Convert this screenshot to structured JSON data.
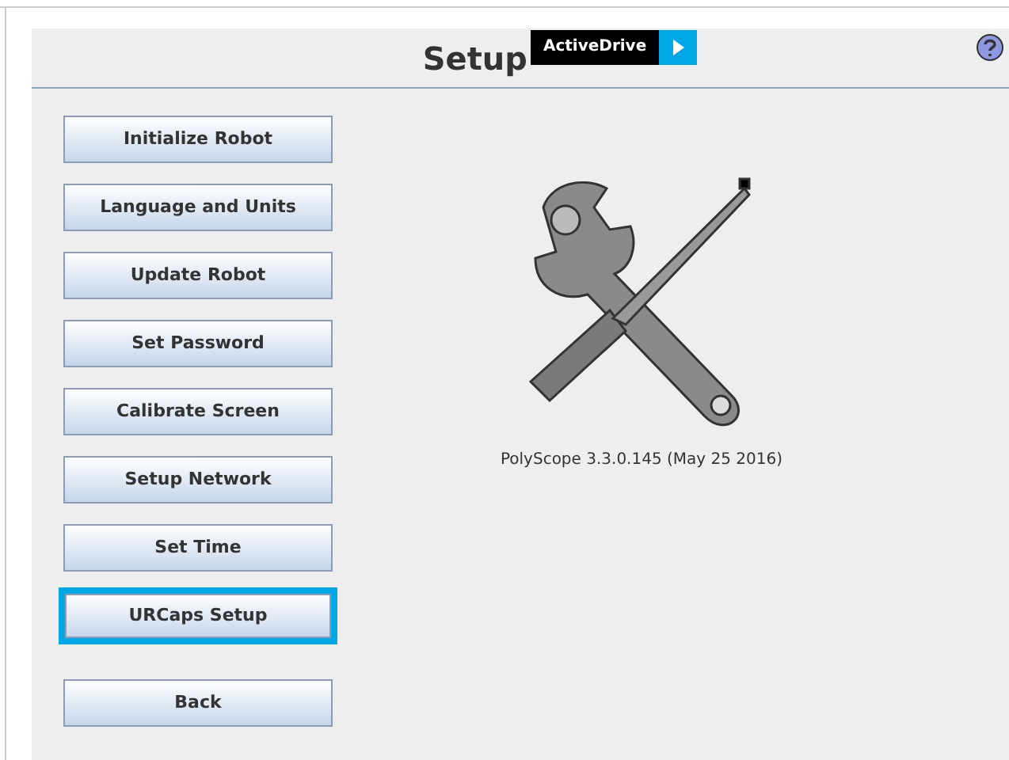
{
  "header": {
    "title": "Setup",
    "badge": {
      "label": "ActiveDrive"
    }
  },
  "menu": [
    {
      "label": "Initialize Robot",
      "selected": false
    },
    {
      "label": "Language and Units",
      "selected": false
    },
    {
      "label": "Update Robot",
      "selected": false
    },
    {
      "label": "Set Password",
      "selected": false
    },
    {
      "label": "Calibrate Screen",
      "selected": false
    },
    {
      "label": "Setup Network",
      "selected": false
    },
    {
      "label": "Set Time",
      "selected": false
    },
    {
      "label": "URCaps Setup",
      "selected": true
    }
  ],
  "back_button": {
    "label": "Back"
  },
  "version": "PolyScope 3.3.0.145 (May 25 2016)"
}
